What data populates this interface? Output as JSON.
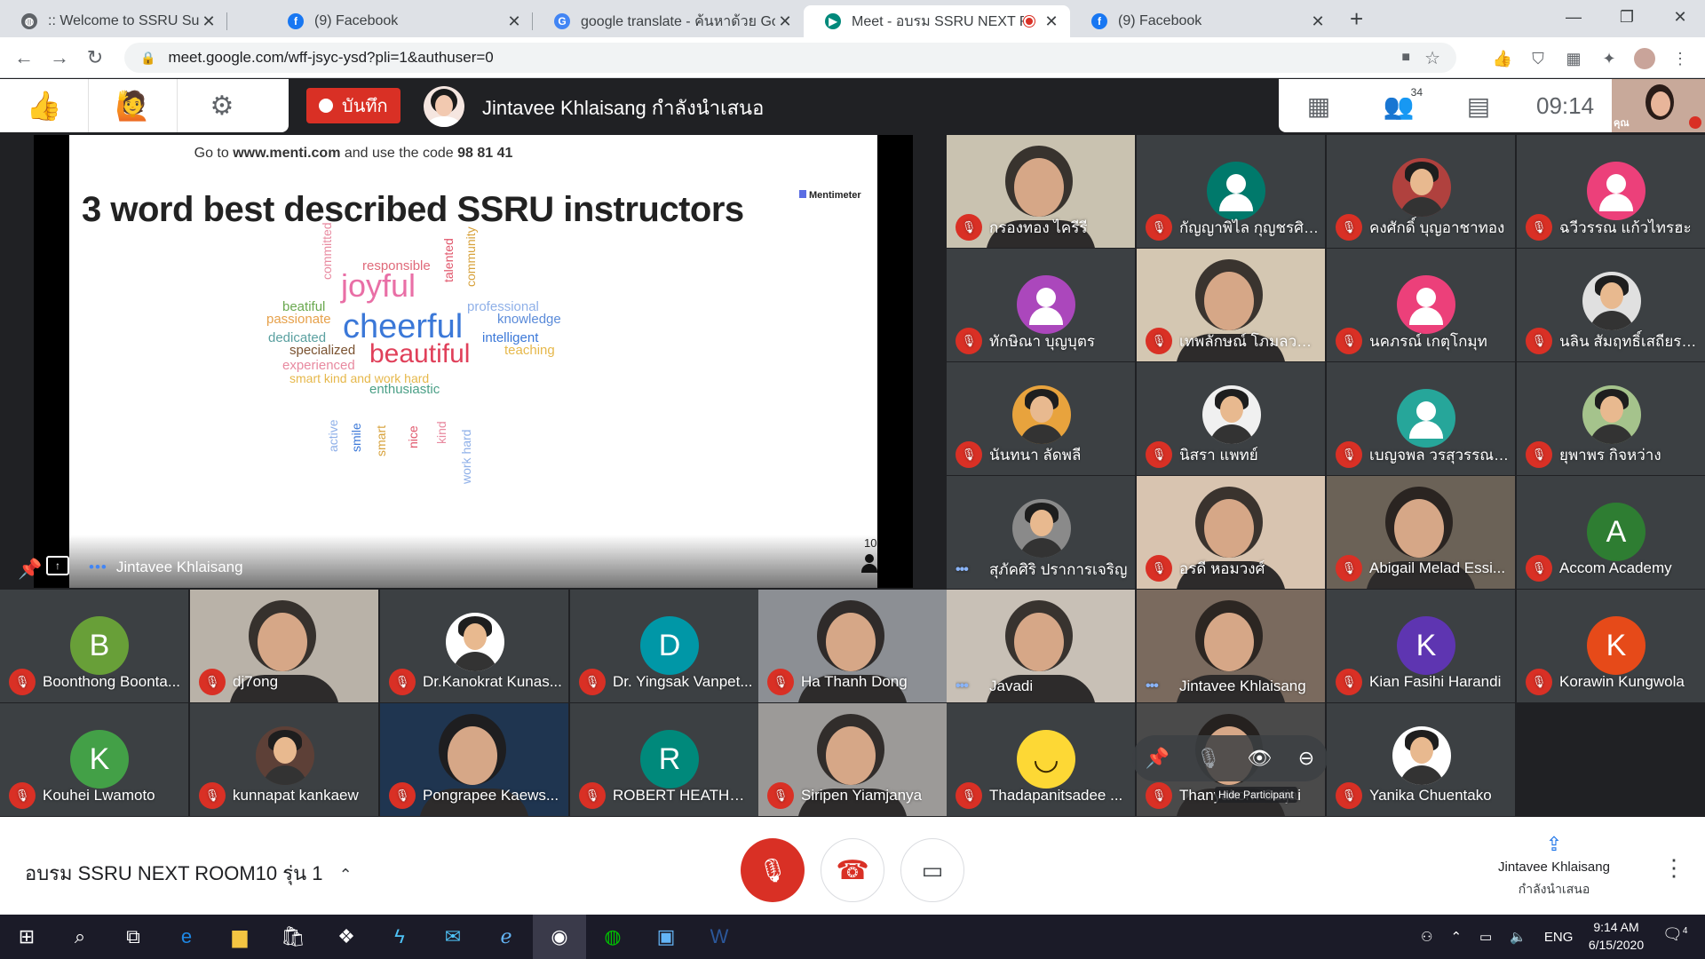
{
  "browser": {
    "tabs": [
      {
        "title": ":: Welcome to SSRU Suan Sunandha",
        "icon": "globe-icon",
        "color": "#5f6368"
      },
      {
        "title": "(9) Facebook",
        "icon": "facebook-icon",
        "color": "#1877f2"
      },
      {
        "title": "google translate - ค้นหาด้วย Google",
        "icon": "google-icon",
        "color": "#4285f4"
      },
      {
        "title": "Meet - อบรม SSRU NEXT ROOM",
        "icon": "meet-icon",
        "color": "#00897b"
      },
      {
        "title": "(9) Facebook",
        "icon": "facebook-icon",
        "color": "#1877f2"
      }
    ],
    "url": "meet.google.com/wff-jsyc-ysd?pli=1&authuser=0"
  },
  "meet_header": {
    "record_label": "บันทึก",
    "presenting_text": "Jintavee Khlaisang กำลังนำเสนอ",
    "participant_count": "34",
    "time": "09:14",
    "self_label": "คุณ"
  },
  "slide": {
    "code_prefix": "Go to",
    "code_site": "www.menti.com",
    "code_mid": "and use the code",
    "code_value": "98 81 41",
    "title": "3 word best described SSRU instructors",
    "logo": "Mentimeter",
    "count": "10",
    "words": [
      {
        "text": "committed",
        "color": "#e88aa0",
        "size": 14
      },
      {
        "text": "responsible",
        "color": "#e06a7a",
        "size": 15
      },
      {
        "text": "joyful",
        "color": "#e96fa6",
        "size": 36
      },
      {
        "text": "talented",
        "color": "#e0556a",
        "size": 14
      },
      {
        "text": "community",
        "color": "#d7a13a",
        "size": 14
      },
      {
        "text": "beatiful",
        "color": "#6aa84f",
        "size": 15
      },
      {
        "text": "passionate",
        "color": "#e6a14b",
        "size": 15
      },
      {
        "text": "professional",
        "color": "#8fb0e8",
        "size": 15
      },
      {
        "text": "knowledge",
        "color": "#5b8bd9",
        "size": 15
      },
      {
        "text": "cheerful",
        "color": "#3b78d8",
        "size": 38
      },
      {
        "text": "dedicated",
        "color": "#5aa0a0",
        "size": 15
      },
      {
        "text": "intelligent",
        "color": "#3b78d8",
        "size": 15
      },
      {
        "text": "specialized",
        "color": "#7a5230",
        "size": 15
      },
      {
        "text": "teaching",
        "color": "#e6b84b",
        "size": 15
      },
      {
        "text": "beautiful",
        "color": "#e0405a",
        "size": 30
      },
      {
        "text": "experienced",
        "color": "#e88aa0",
        "size": 15
      },
      {
        "text": "smart kind and work hard",
        "color": "#e6b84b",
        "size": 14
      },
      {
        "text": "enthusiastic",
        "color": "#4ba087",
        "size": 15
      },
      {
        "text": "active",
        "color": "#8fb0e8",
        "size": 14
      },
      {
        "text": "smile",
        "color": "#3b78d8",
        "size": 14
      },
      {
        "text": "smart",
        "color": "#d7a13a",
        "size": 14
      },
      {
        "text": "nice",
        "color": "#e0556a",
        "size": 14
      },
      {
        "text": "kind",
        "color": "#e88aa0",
        "size": 14
      },
      {
        "text": "work hard",
        "color": "#8fb0e8",
        "size": 14
      }
    ]
  },
  "stage_name": "Jintavee Khlaisang",
  "participants": [
    {
      "name": "กรองทอง ไครีรี",
      "kind": "video",
      "bg": "#c9c2b0",
      "muted": true
    },
    {
      "name": "กัญญาพิไล กุญชรศิริ...",
      "kind": "avatar",
      "bg": "#00796b",
      "muted": true
    },
    {
      "name": "คงศักดิ์ บุญอาชาทอง",
      "kind": "photo",
      "bg": "#b0413e",
      "muted": true
    },
    {
      "name": "ฉวีวรรณ แก้วไทรฮะ",
      "kind": "avatar",
      "bg": "#ec407a",
      "muted": true
    },
    {
      "name": "ทักษิณา บุญบุตร",
      "kind": "avatar",
      "bg": "#ab47bc",
      "muted": true
    },
    {
      "name": "เทพลักษณ์ โภมลวณิช",
      "kind": "video",
      "bg": "#d4c7b2",
      "muted": true
    },
    {
      "name": "นคภรณ์ เกตุโกมุท",
      "kind": "avatar",
      "bg": "#ec407a",
      "muted": true
    },
    {
      "name": "นลิน สัมฤทธิ์เสถียรโสภณ",
      "kind": "photo",
      "bg": "#e0e0e0",
      "muted": true
    },
    {
      "name": "นันทนา ลัดพลี",
      "kind": "photo",
      "bg": "#e8a33d",
      "muted": true
    },
    {
      "name": "นิสรา แพทย์",
      "kind": "photo",
      "bg": "#f0f0f0",
      "muted": true
    },
    {
      "name": "เบญจพล วรสุวรรณรั...",
      "kind": "avatar",
      "bg": "#26a69a",
      "muted": true
    },
    {
      "name": "ยุพาพร กิจหว่าง",
      "kind": "photo",
      "bg": "#a5c38c",
      "muted": true
    },
    {
      "name": "สุภัคศิริ ปราการเจริญ",
      "kind": "photo",
      "bg": "#8a8a8a",
      "muted": false
    },
    {
      "name": "อรดี หอมวงศ์",
      "kind": "video",
      "bg": "#d8c4b0",
      "muted": true
    },
    {
      "name": "Abigail Melad Essi...",
      "kind": "video",
      "bg": "#6b6257",
      "muted": true
    },
    {
      "name": "Accom Academy",
      "kind": "avatar",
      "bg": "#2e7d32",
      "initial": "A",
      "muted": true
    },
    {
      "name": "Boonthong Boonta...",
      "kind": "avatar",
      "bg": "#689f38",
      "initial": "B",
      "muted": true
    },
    {
      "name": "dj7ong",
      "kind": "video",
      "bg": "#b9b2a8",
      "muted": true
    },
    {
      "name": "Dr.Kanokrat Kunas...",
      "kind": "photo",
      "bg": "#ffffff",
      "muted": true
    },
    {
      "name": "Dr. Yingsak Vanpet...",
      "kind": "avatar",
      "bg": "#0097a7",
      "initial": "D",
      "muted": true
    },
    {
      "name": "Ha Thanh Dong",
      "kind": "video",
      "bg": "#8c8f94",
      "muted": true
    },
    {
      "name": "Javadi",
      "kind": "video",
      "bg": "#c8c0b6",
      "muted": false
    },
    {
      "name": "Jintavee Khlaisang",
      "kind": "video",
      "bg": "#7a6a5e",
      "muted": false
    },
    {
      "name": "Kian Fasihi Harandi",
      "kind": "avatar",
      "bg": "#5e35b1",
      "initial": "K",
      "muted": true
    },
    {
      "name": "Korawin Kungwola",
      "kind": "avatar",
      "bg": "#e64a19",
      "initial": "K",
      "muted": true
    },
    {
      "name": "Kouhei Lwamoto",
      "kind": "avatar",
      "bg": "#43a047",
      "initial": "K",
      "muted": true
    },
    {
      "name": "kunnapat kankaew",
      "kind": "photo",
      "bg": "#5d4037",
      "muted": true
    },
    {
      "name": "Pongrapee Kaews...",
      "kind": "video",
      "bg": "#1f3550",
      "muted": true
    },
    {
      "name": "ROBERT HEATHFI...",
      "kind": "avatar",
      "bg": "#00897b",
      "initial": "R",
      "muted": true
    },
    {
      "name": "Siripen Yiamjanya",
      "kind": "video",
      "bg": "#9c9a98",
      "muted": true
    },
    {
      "name": "Thadapanitsadee ...",
      "kind": "emoji",
      "bg": "#fdd835",
      "muted": true
    },
    {
      "name": "Thanyakorn Sutjai",
      "kind": "video",
      "bg": "#4a4a4a",
      "muted": true
    },
    {
      "name": "Yanika Chuentako",
      "kind": "photo",
      "bg": "#ffffff",
      "muted": true
    }
  ],
  "hover_tooltip": "Hide Participant",
  "bottom": {
    "meeting_name": "อบรม SSRU NEXT ROOM10 รุ่น 1",
    "presenter": "Jintavee Khlaisang",
    "presenter_status": "กำลังนำเสนอ"
  },
  "taskbar": {
    "lang": "ENG",
    "time": "9:14 AM",
    "date": "6/15/2020",
    "notifications": "4"
  }
}
